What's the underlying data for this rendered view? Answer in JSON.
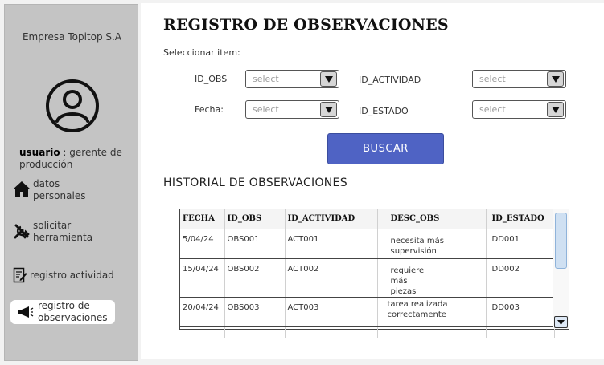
{
  "sidebar": {
    "company": "Empresa Topitop S.A",
    "user_label": "usuario",
    "user_role": " : gerente de producción",
    "items": [
      {
        "label": "datos personales",
        "icon": "home-icon"
      },
      {
        "label": "solicitar herramienta",
        "icon": "tools-icon"
      },
      {
        "label": "registro actividad",
        "icon": "edit-document-icon"
      },
      {
        "label": "registro de observaciones",
        "icon": "megaphone-icon",
        "active": true
      }
    ]
  },
  "main": {
    "title": "REGISTRO DE OBSERVACIONES",
    "subtitle": "Seleccionar item:",
    "filters": {
      "id_obs": {
        "label": "ID_OBS",
        "placeholder": "select"
      },
      "id_actividad": {
        "label": "ID_ACTIVIDAD",
        "placeholder": "select"
      },
      "fecha": {
        "label": "Fecha:",
        "placeholder": "select"
      },
      "id_estado": {
        "label": "ID_ESTADO",
        "placeholder": "select"
      }
    },
    "search_button": "BUSCAR",
    "history_title": "HISTORIAL DE OBSERVACIONES",
    "table": {
      "headers": [
        "FECHA",
        "ID_OBS",
        "ID_ACTIVIDAD",
        "DESC_OBS",
        "ID_ESTADO"
      ],
      "rows": [
        [
          "5/04/24",
          "OBS001",
          "ACT001",
          "necesita más supervisión",
          "DD001"
        ],
        [
          "15/04/24",
          "OBS002",
          "ACT002",
          "requiere más piezas",
          "DD002"
        ],
        [
          "20/04/24",
          "OBS003",
          "ACT003",
          "tarea realizada correctamente",
          "DD003"
        ]
      ]
    }
  },
  "colors": {
    "sidebar": "#c4c4c4",
    "button": "#4f63c4",
    "scroll_thumb": "#cfe0f2"
  }
}
